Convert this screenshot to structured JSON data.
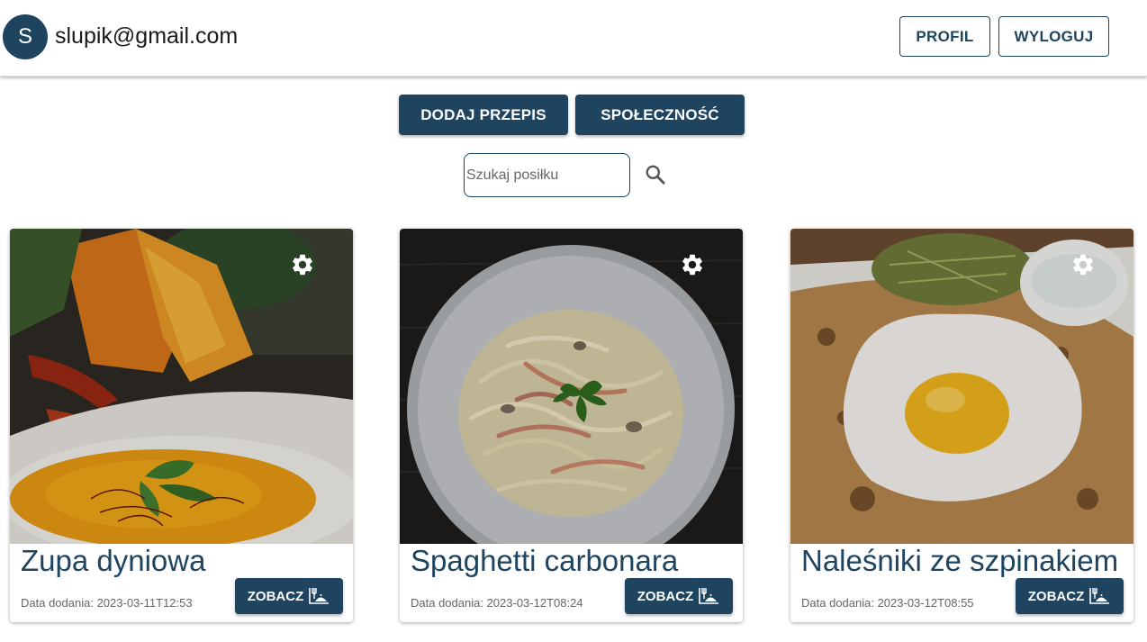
{
  "header": {
    "avatar_letter": "S",
    "email": "slupik@gmail.com",
    "profile_label": "PROFIL",
    "logout_label": "WYLOGUJ"
  },
  "actions": {
    "add_recipe_label": "DODAJ PRZEPIS",
    "community_label": "SPOŁECZNOŚĆ"
  },
  "search": {
    "placeholder": "Szukaj posiłku",
    "value": ""
  },
  "recipes": [
    {
      "title": "Zupa dyniowa",
      "date": "Data dodania: 2023-03-11T12:53",
      "button_label": "ZOBACZ"
    },
    {
      "title": "Spaghetti carbonara",
      "date": "Data dodania: 2023-03-12T08:24",
      "button_label": "ZOBACZ"
    },
    {
      "title": "Naleśniki ze szpinakiem",
      "date": "Data dodania: 2023-03-12T08:55",
      "button_label": "ZOBACZ"
    }
  ],
  "colors": {
    "primary": "#1e4460",
    "text_secondary": "#666666"
  }
}
